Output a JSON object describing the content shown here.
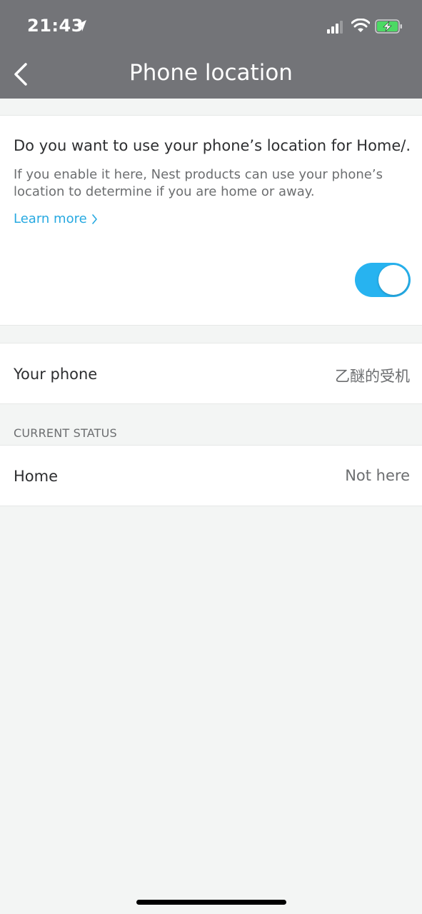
{
  "status_bar": {
    "time": "21:43",
    "icons": [
      "location-arrow-icon",
      "cellular-signal-icon",
      "wifi-icon",
      "battery-charging-icon"
    ]
  },
  "nav": {
    "title": "Phone location",
    "back_icon": "chevron-left-icon"
  },
  "location_card": {
    "question": "Do you want to use your phone’s location for Home/...",
    "description": "If you enable it here, Nest products can use your phone’s location to determine if you are home or away.",
    "learn_more": "Learn more",
    "toggle_on": true
  },
  "phone_row": {
    "label": "Your phone",
    "value": "乙醚的受机"
  },
  "current_status": {
    "section_title": "CURRENT STATUS",
    "label": "Home",
    "value": "Not here"
  },
  "colors": {
    "header_bg": "#737478",
    "accent": "#27a9e1",
    "toggle_on": "#27b3f0",
    "page_bg": "#f3f5f4"
  }
}
